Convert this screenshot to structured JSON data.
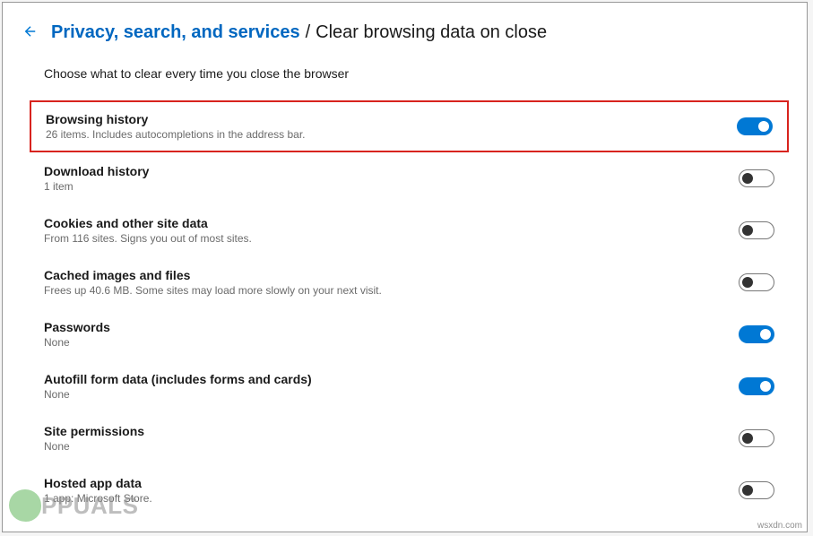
{
  "breadcrumb": {
    "parent": "Privacy, search, and services",
    "separator": "/",
    "current": "Clear browsing data on close"
  },
  "intro": "Choose what to clear every time you close the browser",
  "settings": [
    {
      "title": "Browsing history",
      "desc": "26 items. Includes autocompletions in the address bar.",
      "on": true
    },
    {
      "title": "Download history",
      "desc": "1 item",
      "on": false
    },
    {
      "title": "Cookies and other site data",
      "desc": "From 116 sites. Signs you out of most sites.",
      "on": false
    },
    {
      "title": "Cached images and files",
      "desc": "Frees up 40.6 MB. Some sites may load more slowly on your next visit.",
      "on": false
    },
    {
      "title": "Passwords",
      "desc": "None",
      "on": true
    },
    {
      "title": "Autofill form data (includes forms and cards)",
      "desc": "None",
      "on": true
    },
    {
      "title": "Site permissions",
      "desc": "None",
      "on": false
    },
    {
      "title": "Hosted app data",
      "desc": "1 app: Microsoft Store.",
      "on": false
    }
  ],
  "watermark": {
    "text": "PPUALS"
  },
  "credit": "wsxdn.com"
}
